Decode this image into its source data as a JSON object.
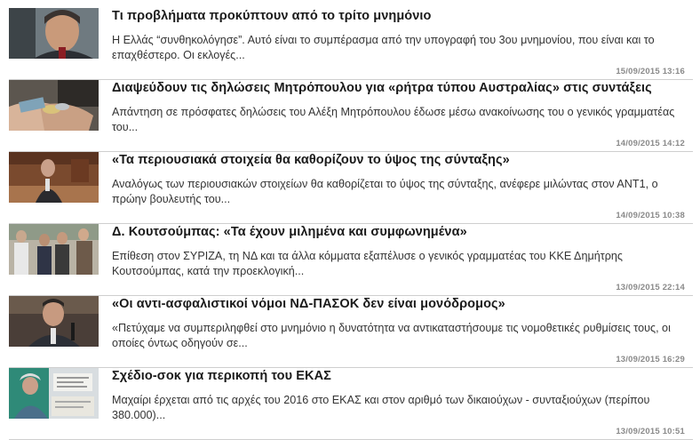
{
  "articles": [
    {
      "title": "Τι προβλήματα προκύπτουν από το τρίτο μνημόνιο",
      "summary": "Η Ελλάς “συνθηκολόγησε”. Αυτό είναι το συμπέρασμα από την υπογραφή του 3ου μνημονίου, που είναι και το επαχθέστερο. Οι εκλογές...",
      "date": "15/09/2015 13:16",
      "thumb_icon": "man-portrait-photo"
    },
    {
      "title": "Διαψεύδουν τις δηλώσεις Μητρόπουλου για «ρήτρα τύπου Αυστραλίας» στις συντάξεις",
      "summary": "Απάντηση σε πρόσφατες δηλώσεις του Αλέξη Μητρόπουλου έδωσε μέσω ανακοίνωσης του ο γενικός γραμματέας του...",
      "date": "14/09/2015 14:12",
      "thumb_icon": "coins-in-hands-photo"
    },
    {
      "title": "«Τα περιουσιακά στοιχεία θα καθορίζουν το ύψος της σύνταξης»",
      "summary": "Αναλόγως των περιουσιακών στοιχείων θα καθορίζεται το ύψος της σύνταξης, ανέφερε μιλώντας στον ΑΝΤ1, ο πρώην βουλευτής του...",
      "date": "14/09/2015 10:38",
      "thumb_icon": "parliament-speaker-photo"
    },
    {
      "title": "Δ. Κουτσούμπας: «Τα έχουν μιλημένα και συμφωνημένα»",
      "summary": "Επίθεση στον ΣΥΡΙΖΑ, τη ΝΔ και τα άλλα κόμματα εξαπέλυσε ο γενικός γραμματέας του ΚΚΕ Δημήτρης Κουτσούμπας, κατά την προεκλογική...",
      "date": "13/09/2015 22:14",
      "thumb_icon": "crowd-photo"
    },
    {
      "title": "«Οι αντι-ασφαλιστικοί νόμοι ΝΔ-ΠΑΣΟΚ δεν είναι μονόδρομος»",
      "summary": "«Πετύχαμε να συμπεριληφθεί στο μνημόνιο η δυνατότητα να αντικαταστήσουμε τις νομοθετικές ρυθμίσεις τους, οι οποίες όντως οδηγούν σε...",
      "date": "13/09/2015 16:29",
      "thumb_icon": "politician-speaking-photo"
    },
    {
      "title": "Σχέδιο-σοκ για περικοπή του ΕΚΑΣ",
      "summary": "Μαχαίρι έρχεται από τις αρχές του 2016 στο ΕΚΑΣ και στον αριθμό των δικαιούχων - συνταξιούχων (περίπου 380.000)...",
      "date": "13/09/2015 10:51",
      "thumb_icon": "pensioner-with-documents-photo"
    }
  ]
}
